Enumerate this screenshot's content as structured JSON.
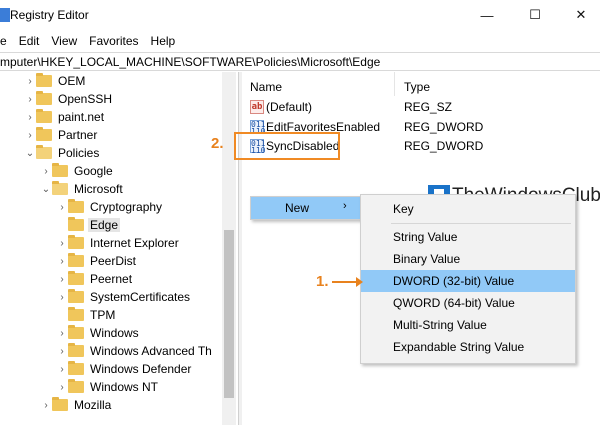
{
  "window": {
    "title": "Registry Editor",
    "minimize": "—",
    "maximize": "☐",
    "close": "✕"
  },
  "menu": [
    "Edit",
    "View",
    "Favorites",
    "Help"
  ],
  "menu_first_partial": "e",
  "address": "mputer\\HKEY_LOCAL_MACHINE\\SOFTWARE\\Policies\\Microsoft\\Edge",
  "tree": {
    "items": [
      {
        "label": "OEM",
        "chev": "›"
      },
      {
        "label": "OpenSSH",
        "chev": "›"
      },
      {
        "label": "paint.net",
        "chev": "›"
      },
      {
        "label": "Partner",
        "chev": "›"
      },
      {
        "label": "Policies",
        "chev": "⌄"
      },
      {
        "label": "Google",
        "chev": "›"
      },
      {
        "label": "Microsoft",
        "chev": "⌄"
      },
      {
        "label": "Cryptography",
        "chev": "›"
      },
      {
        "label": "Edge",
        "chev": ""
      },
      {
        "label": "Internet Explorer",
        "chev": "›"
      },
      {
        "label": "PeerDist",
        "chev": "›"
      },
      {
        "label": "Peernet",
        "chev": "›"
      },
      {
        "label": "SystemCertificates",
        "chev": "›"
      },
      {
        "label": "TPM",
        "chev": ""
      },
      {
        "label": "Windows",
        "chev": "›"
      },
      {
        "label": "Windows Advanced Th",
        "chev": "›"
      },
      {
        "label": "Windows Defender",
        "chev": "›"
      },
      {
        "label": "Windows NT",
        "chev": "›"
      },
      {
        "label": "Mozilla",
        "chev": "›"
      }
    ]
  },
  "list": {
    "col_name": "Name",
    "col_type": "Type",
    "values": [
      {
        "icon": "ab",
        "name": "(Default)",
        "type": "REG_SZ"
      },
      {
        "icon": "bin",
        "name": "EditFavoritesEnabled",
        "type": "REG_DWORD"
      },
      {
        "icon": "bin",
        "name": "SyncDisabled",
        "type": "REG_DWORD"
      }
    ]
  },
  "annotations": {
    "step1": "1.",
    "step2": "2."
  },
  "watermark": "TheWindowsClub",
  "context_menu": {
    "new_label": "New",
    "new_arrow": "›",
    "submenu": [
      "Key",
      "String Value",
      "Binary Value",
      "DWORD (32-bit) Value",
      "QWORD (64-bit) Value",
      "Multi-String Value",
      "Expandable String Value"
    ]
  },
  "colors": {
    "highlight": "#91c9f7",
    "annotation": "#e8821e",
    "folder": "#f0c65b"
  }
}
